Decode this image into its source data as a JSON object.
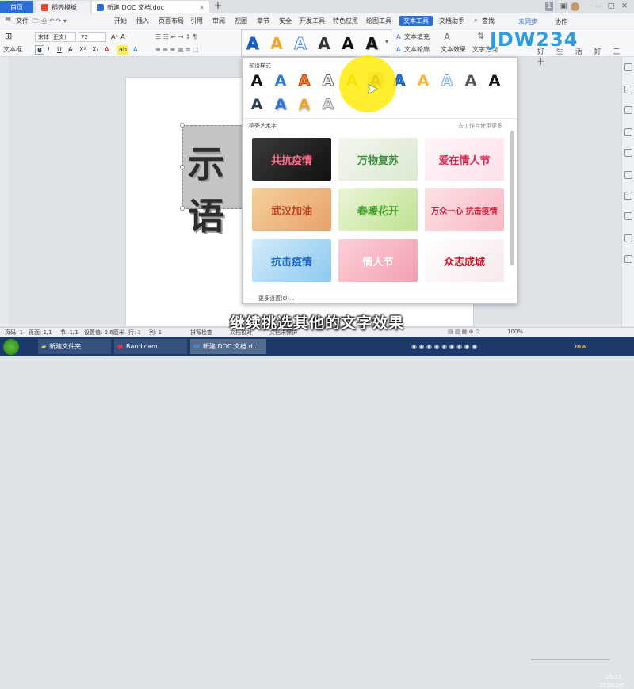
{
  "tabs": {
    "home": "首页",
    "t1": "稻壳模板",
    "t2": "新建 DOC 文档.doc",
    "new": "+"
  },
  "menubar": {
    "file": "文件",
    "items": [
      "开始",
      "插入",
      "页面布局",
      "引用",
      "审阅",
      "视图",
      "章节",
      "安全",
      "开发工具",
      "特色应用",
      "绘图工具",
      "文本工具",
      "文档助手"
    ],
    "search": "查找",
    "unsync": "未同步",
    "collab": "协作"
  },
  "ribbon": {
    "textbox": "文本框",
    "font": "宋体 (正文)",
    "size": "72",
    "fill": "文本填充",
    "outline": "文本轮廓",
    "effect": "文本效果",
    "direction": "文字方向"
  },
  "logo": {
    "text": "JDW234",
    "sub": "好 生 活 好 三 十"
  },
  "panel": {
    "preset_label": "预设样式",
    "art_label": "稻壳艺术字",
    "more_link": "去工作台使用更多",
    "more_settings": "更多设置(O)...",
    "cards": [
      "共抗疫情",
      "万物复苏",
      "爱在情人节",
      "武汉加油",
      "春暖花开",
      "万众一心 抗击疫情",
      "抗击疫情",
      "情人节",
      "众志成城"
    ]
  },
  "doc": {
    "textbox_text": "示语"
  },
  "subtitle": "继续挑选其他的文字效果",
  "status": {
    "page": "页码: 1",
    "pages": "页面: 1/1",
    "section": "节: 1/1",
    "setting": "设置值: 2.6厘米",
    "row": "行: 1",
    "col": "列: 1",
    "spell": "拼写检查",
    "proof": "文档校对",
    "protect": "文档未保护",
    "zoom": "100%"
  },
  "taskbar": {
    "folder": "新建文件夹",
    "bandicam": "Bandicam",
    "wps": "新建 DOC 文档.d...",
    "time": "15:37",
    "date": "2020/2/7"
  },
  "colors": {
    "accent": "#2b6fd6",
    "taskbar": "#1b3a6b",
    "highlight": "#ffec00"
  }
}
